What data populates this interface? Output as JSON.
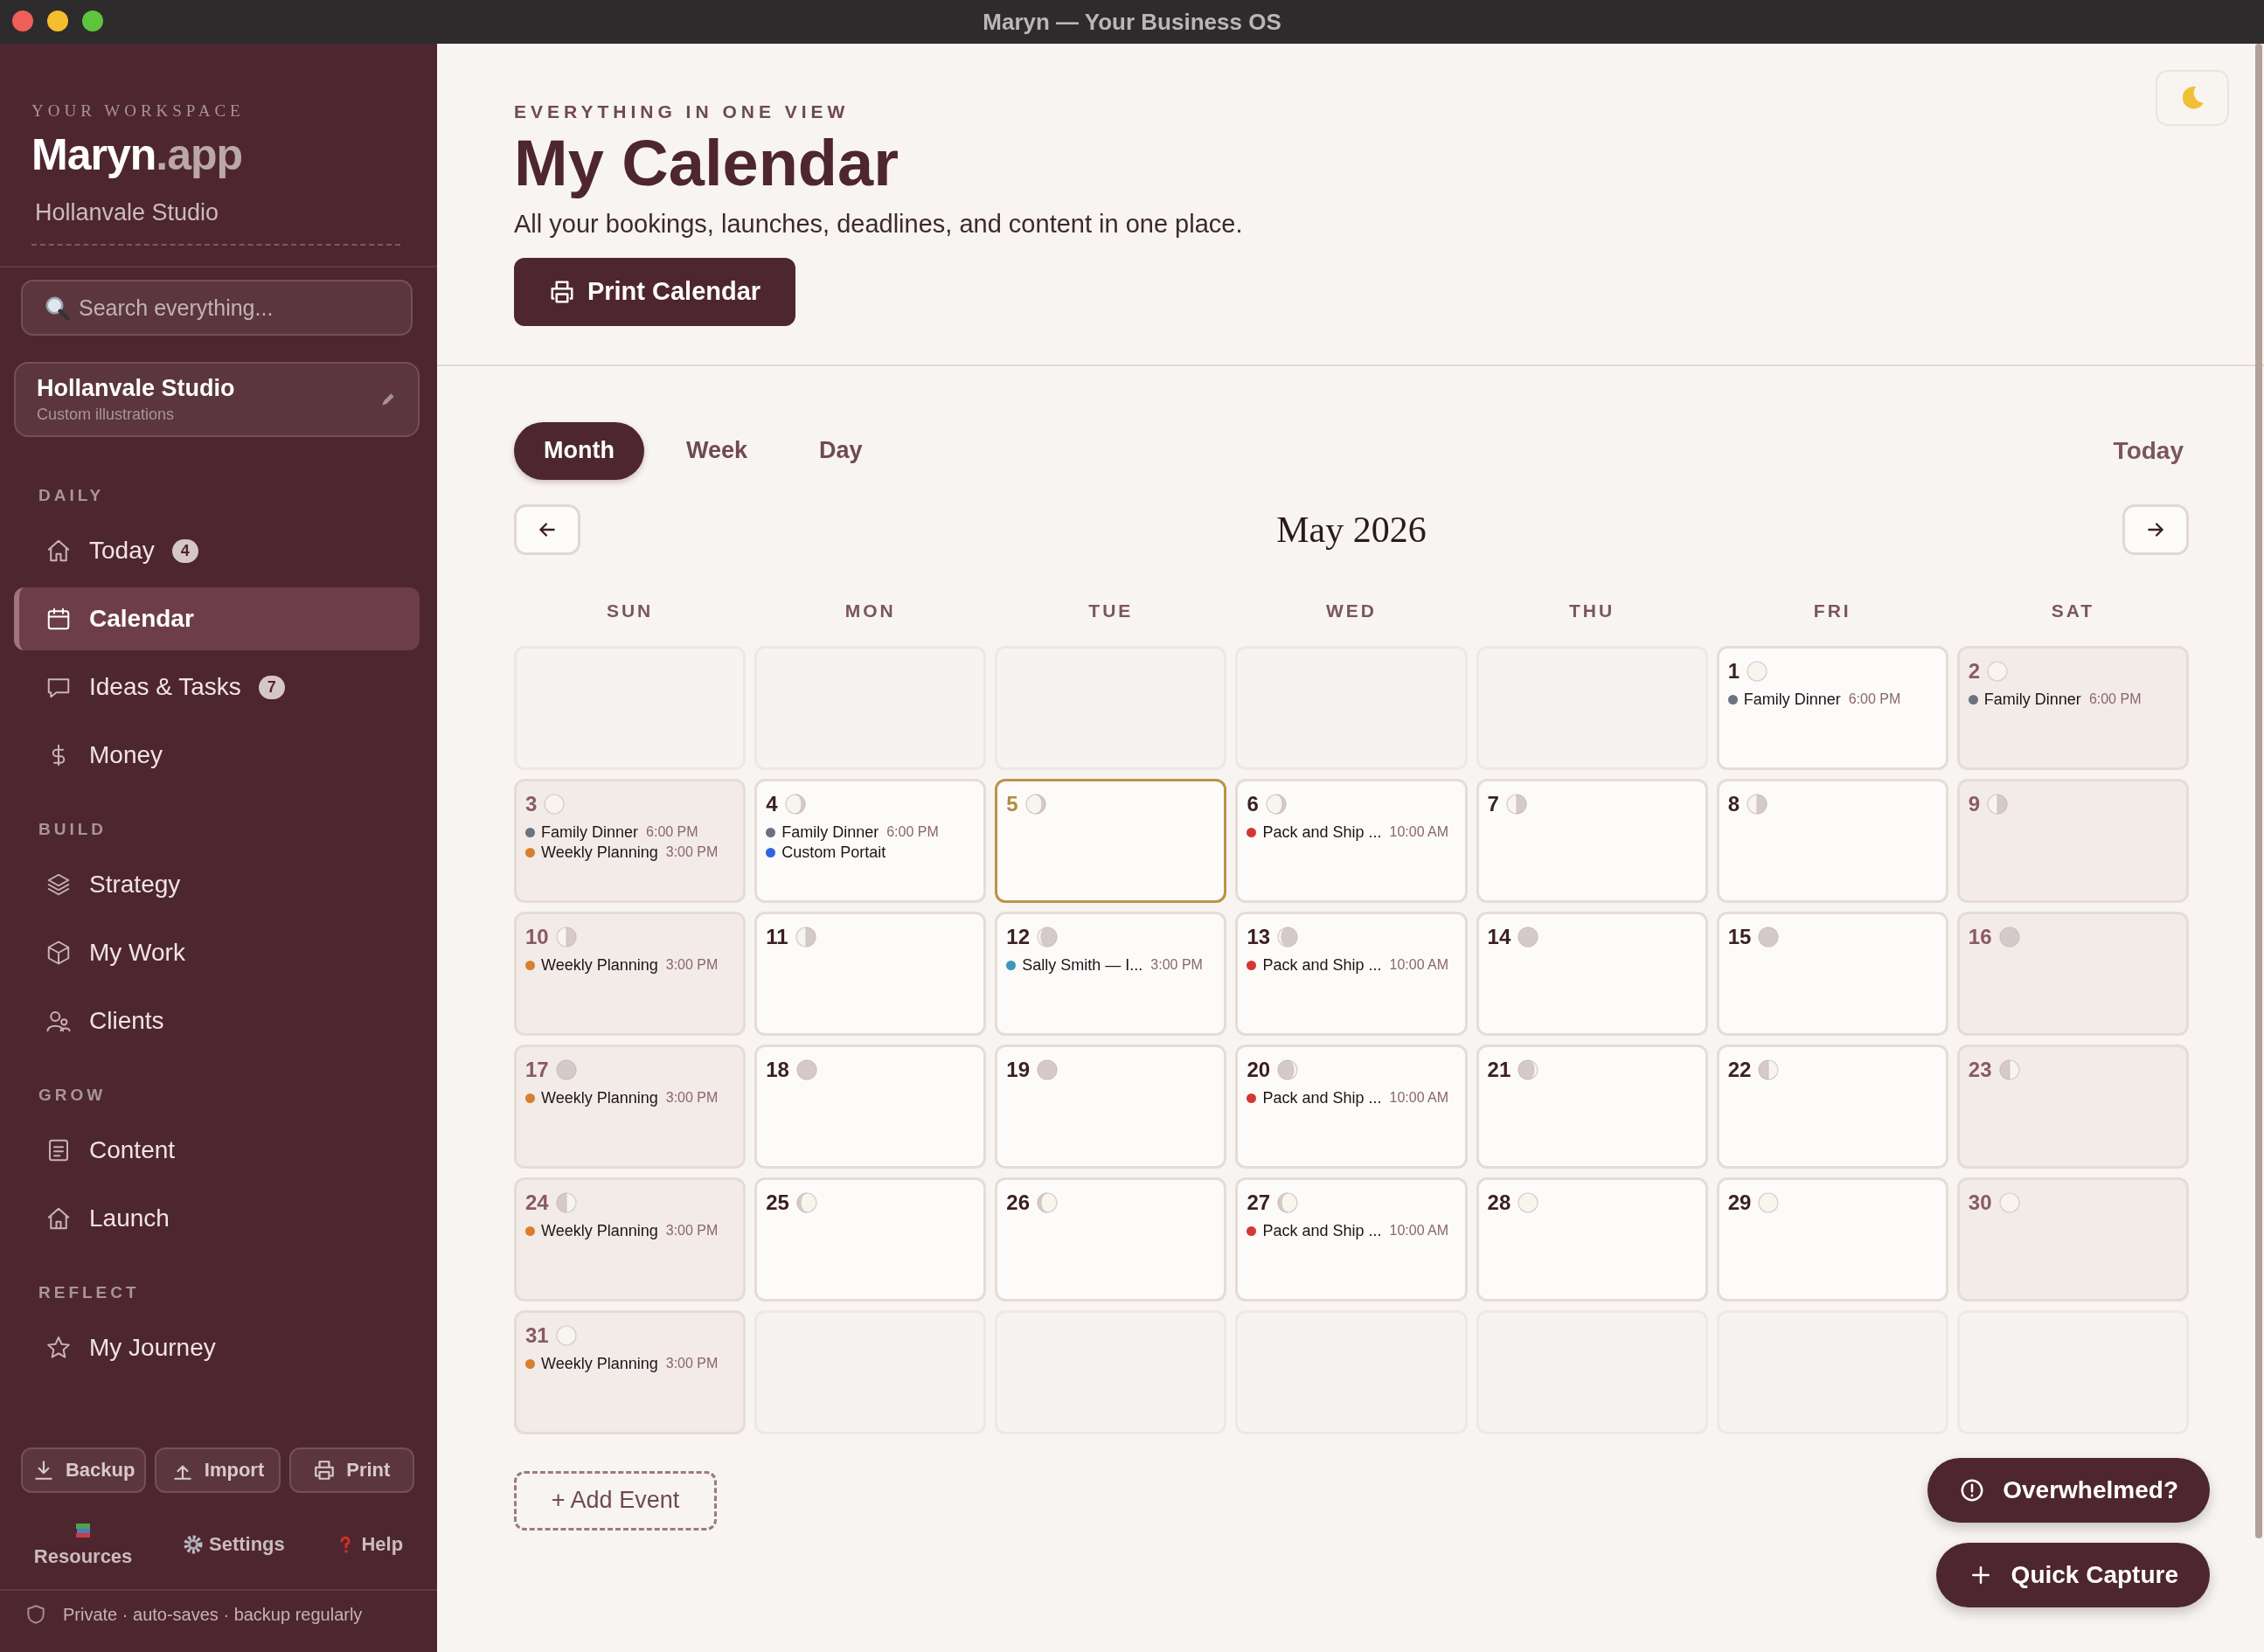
{
  "window": {
    "title": "Maryn — Your Business OS"
  },
  "sidebar": {
    "eyebrow": "YOUR WORKSPACE",
    "brand": "Maryn",
    "brand_suffix": ".app",
    "workspace_name": "Hollanvale Studio",
    "search": {
      "placeholder": "Search everything..."
    },
    "business": {
      "name": "Hollanvale Studio",
      "tagline": "Custom illustrations"
    },
    "sections": [
      {
        "title": "DAILY",
        "items": [
          {
            "label": "Today",
            "badge": "4",
            "selected": false
          },
          {
            "label": "Calendar",
            "selected": true
          },
          {
            "label": "Ideas & Tasks",
            "badge": "7",
            "selected": false
          },
          {
            "label": "Money",
            "selected": false
          }
        ]
      },
      {
        "title": "BUILD",
        "items": [
          {
            "label": "Strategy",
            "selected": false
          },
          {
            "label": "My Work",
            "selected": false
          },
          {
            "label": "Clients",
            "selected": false
          }
        ]
      },
      {
        "title": "GROW",
        "items": [
          {
            "label": "Content",
            "selected": false
          },
          {
            "label": "Launch",
            "selected": false
          }
        ]
      },
      {
        "title": "REFLECT",
        "items": [
          {
            "label": "My Journey",
            "selected": false
          }
        ]
      }
    ],
    "actions": [
      "Backup",
      "Import",
      "Print"
    ],
    "links": [
      "Resources",
      "Settings",
      "Help"
    ],
    "footer_note": "Private · auto-saves · backup regularly"
  },
  "header": {
    "eyebrow": "EVERYTHING IN ONE VIEW",
    "title": "My Calendar",
    "subtitle": "All your bookings, launches, deadlines, and content in one place.",
    "print_button": "Print Calendar"
  },
  "calendar": {
    "views": [
      {
        "label": "Month",
        "selected": true
      },
      {
        "label": "Week",
        "selected": false
      },
      {
        "label": "Day",
        "selected": false
      }
    ],
    "today_button": "Today",
    "month_label": "May 2026",
    "weekdays": [
      "SUN",
      "MON",
      "TUE",
      "WED",
      "THU",
      "FRI",
      "SAT"
    ],
    "weeks": [
      [
        {
          "kind": "blank"
        },
        {
          "kind": "blank"
        },
        {
          "kind": "blank"
        },
        {
          "kind": "blank"
        },
        {
          "kind": "blank"
        },
        {
          "kind": "day",
          "day": "1",
          "moon": {
            "kind": "full"
          },
          "today": false,
          "events": [
            {
              "title": "Family Dinner",
              "time": "6:00 PM",
              "color": "#6b7280"
            }
          ]
        },
        {
          "kind": "day",
          "day": "2",
          "moon": {
            "kind": "full"
          },
          "today": false,
          "events": [
            {
              "title": "Family Dinner",
              "time": "6:00 PM",
              "color": "#6b7280"
            }
          ]
        }
      ],
      [
        {
          "kind": "day",
          "day": "3",
          "moon": {
            "kind": "full"
          },
          "today": false,
          "events": [
            {
              "title": "Family Dinner",
              "time": "6:00 PM",
              "color": "#6b7280"
            },
            {
              "title": "Weekly Planning",
              "time": "3:00 PM",
              "color": "#d97f2e"
            }
          ]
        },
        {
          "kind": "day",
          "day": "4",
          "moon": {
            "kind": "waning-gibbous"
          },
          "today": false,
          "events": [
            {
              "title": "Family Dinner",
              "time": "6:00 PM",
              "color": "#6b7280"
            },
            {
              "title": "Custom Portait",
              "color": "#2f66e0"
            }
          ]
        },
        {
          "kind": "day",
          "day": "5",
          "moon": {
            "kind": "waning-gibbous"
          },
          "today": true
        },
        {
          "kind": "day",
          "day": "6",
          "moon": {
            "kind": "waning-gibbous"
          },
          "today": false,
          "events": [
            {
              "title": "Pack and Ship ...",
              "time": "10:00 AM",
              "color": "#d13a32"
            }
          ]
        },
        {
          "kind": "day",
          "day": "7",
          "moon": {
            "kind": "last-quarter"
          },
          "today": false
        },
        {
          "kind": "day",
          "day": "8",
          "moon": {
            "kind": "last-quarter"
          },
          "today": false
        },
        {
          "kind": "day",
          "day": "9",
          "moon": {
            "kind": "last-quarter"
          },
          "today": false
        }
      ],
      [
        {
          "kind": "day",
          "day": "10",
          "moon": {
            "kind": "last-quarter"
          },
          "today": false,
          "events": [
            {
              "title": "Weekly Planning",
              "time": "3:00 PM",
              "color": "#d97f2e"
            }
          ]
        },
        {
          "kind": "day",
          "day": "11",
          "moon": {
            "kind": "last-quarter"
          },
          "today": false
        },
        {
          "kind": "day",
          "day": "12",
          "moon": {
            "kind": "waning-crescent"
          },
          "today": false,
          "events": [
            {
              "title": "Sally Smith — I...",
              "time": "3:00 PM",
              "color": "#3d97b8"
            }
          ]
        },
        {
          "kind": "day",
          "day": "13",
          "moon": {
            "kind": "waning-crescent"
          },
          "today": false,
          "events": [
            {
              "title": "Pack and Ship ...",
              "time": "10:00 AM",
              "color": "#d13a32"
            }
          ]
        },
        {
          "kind": "day",
          "day": "14",
          "moon": {
            "kind": "new"
          },
          "today": false
        },
        {
          "kind": "day",
          "day": "15",
          "moon": {
            "kind": "new"
          },
          "today": false
        },
        {
          "kind": "day",
          "day": "16",
          "moon": {
            "kind": "new"
          },
          "today": false
        }
      ],
      [
        {
          "kind": "day",
          "day": "17",
          "moon": {
            "kind": "new"
          },
          "today": false,
          "events": [
            {
              "title": "Weekly Planning",
              "time": "3:00 PM",
              "color": "#d97f2e"
            }
          ]
        },
        {
          "kind": "day",
          "day": "18",
          "moon": {
            "kind": "new"
          },
          "today": false
        },
        {
          "kind": "day",
          "day": "19",
          "moon": {
            "kind": "new"
          },
          "today": false
        },
        {
          "kind": "day",
          "day": "20",
          "moon": {
            "kind": "waxing-crescent"
          },
          "today": false,
          "events": [
            {
              "title": "Pack and Ship ...",
              "time": "10:00 AM",
              "color": "#d13a32"
            }
          ]
        },
        {
          "kind": "day",
          "day": "21",
          "moon": {
            "kind": "waxing-crescent"
          },
          "today": false
        },
        {
          "kind": "day",
          "day": "22",
          "moon": {
            "kind": "first-quarter"
          },
          "today": false
        },
        {
          "kind": "day",
          "day": "23",
          "moon": {
            "kind": "first-quarter"
          },
          "today": false
        }
      ],
      [
        {
          "kind": "day",
          "day": "24",
          "moon": {
            "kind": "first-quarter"
          },
          "today": false,
          "events": [
            {
              "title": "Weekly Planning",
              "time": "3:00 PM",
              "color": "#d97f2e"
            }
          ]
        },
        {
          "kind": "day",
          "day": "25",
          "moon": {
            "kind": "waxing-gibbous"
          },
          "today": false
        },
        {
          "kind": "day",
          "day": "26",
          "moon": {
            "kind": "waxing-gibbous"
          },
          "today": false
        },
        {
          "kind": "day",
          "day": "27",
          "moon": {
            "kind": "waxing-gibbous"
          },
          "today": false,
          "events": [
            {
              "title": "Pack and Ship ...",
              "time": "10:00 AM",
              "color": "#d13a32"
            }
          ]
        },
        {
          "kind": "day",
          "day": "28",
          "moon": {
            "kind": "full"
          },
          "today": false
        },
        {
          "kind": "day",
          "day": "29",
          "moon": {
            "kind": "full"
          },
          "today": false
        },
        {
          "kind": "day",
          "day": "30",
          "moon": {
            "kind": "full"
          },
          "today": false
        }
      ],
      [
        {
          "kind": "day",
          "day": "31",
          "moon": {
            "kind": "full"
          },
          "today": false,
          "events": [
            {
              "title": "Weekly Planning",
              "time": "3:00 PM",
              "color": "#d97f2e"
            }
          ]
        },
        {
          "kind": "blank"
        },
        {
          "kind": "blank"
        },
        {
          "kind": "blank"
        },
        {
          "kind": "blank"
        },
        {
          "kind": "blank"
        },
        {
          "kind": "blank"
        }
      ]
    ]
  },
  "add_event": "+ Add Event",
  "floating": {
    "overwhelmed": "Overwhelmed?",
    "quick_capture": "Quick Capture"
  }
}
